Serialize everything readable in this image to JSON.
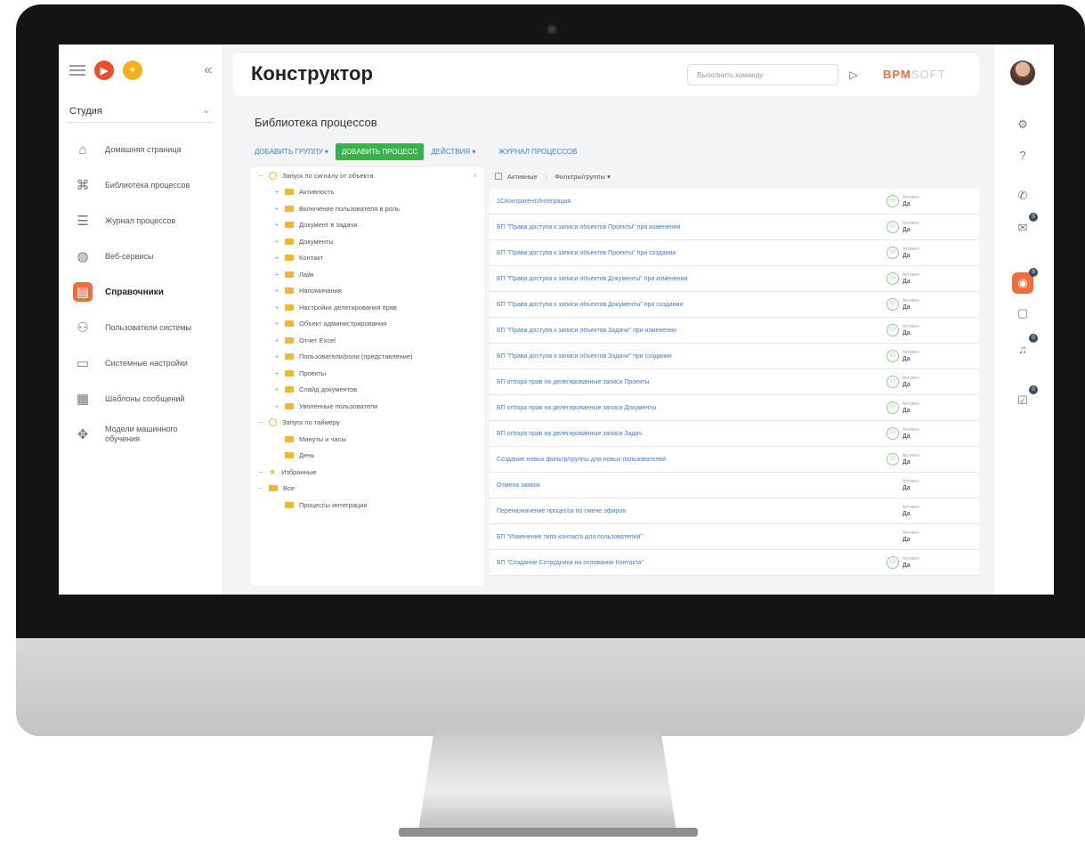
{
  "sidebar": {
    "studio_label": "Студия",
    "items": [
      {
        "label": "Домашняя страница",
        "icon": "home-icon"
      },
      {
        "label": "Библиотека процессов",
        "icon": "process-library-icon"
      },
      {
        "label": "Журнал процессов",
        "icon": "process-log-icon"
      },
      {
        "label": "Веб-сервисы",
        "icon": "globe-icon"
      },
      {
        "label": "Справочники",
        "icon": "lookups-icon",
        "active": true
      },
      {
        "label": "Пользователи системы",
        "icon": "users-icon"
      },
      {
        "label": "Системные настройки",
        "icon": "system-settings-icon"
      },
      {
        "label": "Шаблоны сообщений",
        "icon": "message-templates-icon"
      },
      {
        "label": "Модели машинного обучения",
        "icon": "ml-models-icon"
      }
    ]
  },
  "header": {
    "title": "Конструктор",
    "command_placeholder": "Выполнить команду",
    "brand_part1": "BPM",
    "brand_part2": "SOFT"
  },
  "library": {
    "title": "Библиотека процессов",
    "toolbar": {
      "add_group": "Добавить группу ▾",
      "add_process": "Добавить процесс",
      "actions": "Действия ▾",
      "process_log": "Журнал процессов"
    },
    "filters": {
      "active": "Активные",
      "filters_groups": "Фильтры/группы ▾"
    }
  },
  "tree": [
    {
      "label": "Запуск по сигналу от объекта",
      "level": 0,
      "kind": "gear",
      "toggle": "−",
      "close": "×"
    },
    {
      "label": "Активность",
      "level": 1,
      "kind": "folder",
      "toggle": "+"
    },
    {
      "label": "Включение пользователя в роль",
      "level": 1,
      "kind": "folder",
      "toggle": "+"
    },
    {
      "label": "Документ в задачи",
      "level": 1,
      "kind": "folder",
      "toggle": "+"
    },
    {
      "label": "Документы",
      "level": 1,
      "kind": "folder",
      "toggle": "+"
    },
    {
      "label": "Контакт",
      "level": 1,
      "kind": "folder",
      "toggle": "+"
    },
    {
      "label": "Лайк",
      "level": 1,
      "kind": "folder",
      "toggle": "+"
    },
    {
      "label": "Напоминания",
      "level": 1,
      "kind": "folder",
      "toggle": "+"
    },
    {
      "label": "Настройки делегирования прав",
      "level": 1,
      "kind": "folder",
      "toggle": "+"
    },
    {
      "label": "Объект администрирования",
      "level": 1,
      "kind": "folder",
      "toggle": "+"
    },
    {
      "label": "Отчет Excel",
      "level": 1,
      "kind": "folder",
      "toggle": "+"
    },
    {
      "label": "Пользователи/роли (представление)",
      "level": 1,
      "kind": "folder",
      "toggle": "+"
    },
    {
      "label": "Проекты",
      "level": 1,
      "kind": "folder",
      "toggle": "+"
    },
    {
      "label": "Слайд документов",
      "level": 1,
      "kind": "folder",
      "toggle": "+"
    },
    {
      "label": "Уволенные пользователи",
      "level": 1,
      "kind": "folder",
      "toggle": "+"
    },
    {
      "label": "Запуск по таймеру",
      "level": 0,
      "kind": "gear",
      "toggle": "−"
    },
    {
      "label": "Минуты и часы",
      "level": 1,
      "kind": "folder",
      "toggle": ""
    },
    {
      "label": "День",
      "level": 1,
      "kind": "folder",
      "toggle": ""
    },
    {
      "label": "Избранные",
      "level": 0,
      "kind": "star",
      "toggle": "−"
    },
    {
      "label": "Все",
      "level": 0,
      "kind": "folder",
      "toggle": "−"
    },
    {
      "label": "Процессы интеграции",
      "level": 1,
      "kind": "folder",
      "toggle": ""
    }
  ],
  "status_key": "Активен",
  "processes": [
    {
      "name": "1СКонтрагентИнтеграция",
      "active": "Да",
      "icon": true
    },
    {
      "name": "БП \"Права доступа к записи объектов Проекты\" при изменении",
      "active": "Да",
      "icon": true
    },
    {
      "name": "БП \"Права доступа к записи объектов Проекты\" при создании",
      "active": "Да",
      "icon": true
    },
    {
      "name": "БП \"Права доступа к записи объектов Документы\" при изменении",
      "active": "Да",
      "icon": true
    },
    {
      "name": "БП \"Права доступа к записи объектов Документы\" при создании",
      "active": "Да",
      "icon": true
    },
    {
      "name": "БП \"Права доступа к записи объектов Задачи\" при изменении",
      "active": "Да",
      "icon": true
    },
    {
      "name": "БП \"Права доступа к записи объектов Задачи\" при создании",
      "active": "Да",
      "icon": true
    },
    {
      "name": "БП отбора прав на делегированные записи Проекты",
      "active": "Да",
      "icon": true
    },
    {
      "name": "БП отбора прав на делегированные записи Документы",
      "active": "Да",
      "icon": true
    },
    {
      "name": "БП отбора прав на делегированные записи Задач",
      "active": "Да",
      "icon": true
    },
    {
      "name": "Создание новых фильтр/группы для новых пользователей",
      "active": "Да",
      "icon": true
    },
    {
      "name": "Отмена заявок",
      "active": "Да",
      "icon": false
    },
    {
      "name": "Переназначение процесса по смене эфиров",
      "active": "Да",
      "icon": false
    },
    {
      "name": "БП \"Изменение типа контакта для пользователей\"",
      "active": "Да",
      "icon": false
    },
    {
      "name": "БП \"Создание Сотрудника на основании Контакта\"",
      "active": "Да",
      "icon": true
    }
  ],
  "right_rail": [
    {
      "icon": "settings-icon"
    },
    {
      "icon": "help-icon"
    },
    {
      "icon": "phone-icon"
    },
    {
      "icon": "email-icon",
      "badge": "0"
    },
    {
      "icon": "feed-icon",
      "badge": "0",
      "active": true
    },
    {
      "icon": "chat-icon"
    },
    {
      "icon": "notifications-icon",
      "badge": "0"
    },
    {
      "icon": "tasks-icon",
      "badge": "0"
    }
  ],
  "colors": {
    "accent": "#f36d3c",
    "primary_button": "#37b24d",
    "link": "#3e7cd6"
  }
}
